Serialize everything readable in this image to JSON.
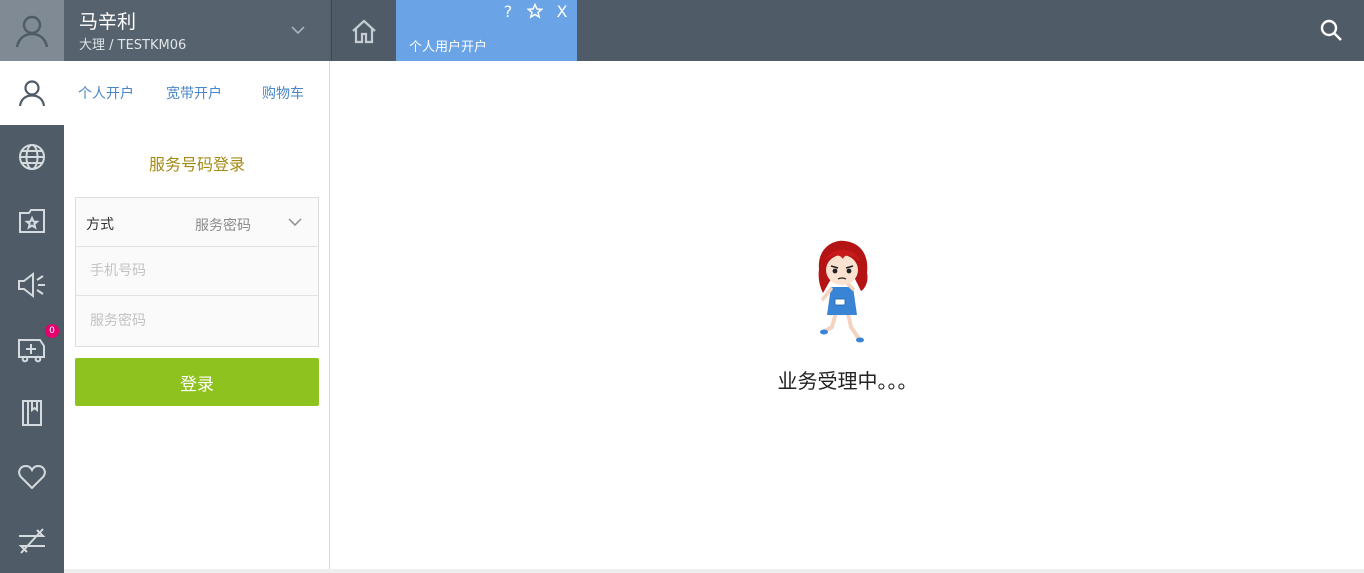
{
  "user": {
    "name": "马辛利",
    "sub": "大理 / TESTKM06"
  },
  "tabs": [
    {
      "label": "个人用户开户",
      "active": true
    }
  ],
  "tab_actions": {
    "help": "?",
    "close": "X"
  },
  "sidebar": {
    "items": [
      {
        "icon": "user-icon",
        "active": true
      },
      {
        "icon": "globe-icon"
      },
      {
        "icon": "folder-star-icon"
      },
      {
        "icon": "megaphone-icon"
      },
      {
        "icon": "cart-plus-icon",
        "badge": "0"
      },
      {
        "icon": "book-icon"
      },
      {
        "icon": "heart-icon"
      },
      {
        "icon": "swap-icon"
      }
    ]
  },
  "subnav": {
    "items": [
      "个人开户",
      "宽带开户",
      "购物车"
    ]
  },
  "login": {
    "title": "服务号码登录",
    "method_label": "方式",
    "method_value": "服务密码",
    "phone_placeholder": "手机号码",
    "password_placeholder": "服务密码",
    "submit_label": "登录"
  },
  "main": {
    "loading_text": "业务受理中。。。"
  },
  "colors": {
    "topbar": "#4f5b66",
    "active_tab": "#6aa3e6",
    "login_button": "#8dc21f",
    "title": "#a58a14",
    "badge": "#e5006e"
  }
}
